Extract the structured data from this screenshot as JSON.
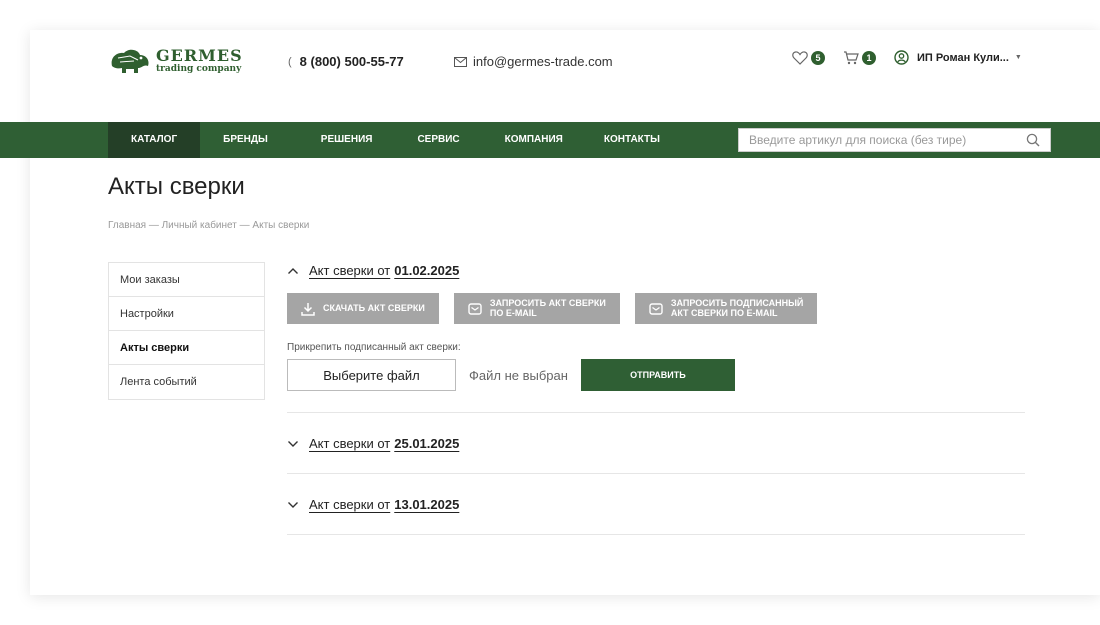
{
  "header": {
    "logo": {
      "name": "GERMES",
      "subtitle": "trading company"
    },
    "phone": "8 (800) 500-55-77",
    "email": "info@germes-trade.com",
    "favorites_count": "5",
    "cart_count": "1",
    "user_name": "ИП Роман Кули...",
    "icons": {
      "phone": "phone-icon",
      "email": "envelope-icon",
      "favorites": "heart-icon",
      "cart": "cart-icon",
      "user": "user-circle-icon",
      "user_menu": "caret-down-icon"
    }
  },
  "nav": {
    "items": [
      {
        "label": "КАТАЛОГ",
        "active": true
      },
      {
        "label": "БРЕНДЫ"
      },
      {
        "label": "РЕШЕНИЯ"
      },
      {
        "label": "СЕРВИС"
      },
      {
        "label": "КОМПАНИЯ"
      },
      {
        "label": "КОНТАКТЫ"
      }
    ],
    "search_placeholder": "Введите артикул для поиска (без тире)",
    "search_icon": "search-icon"
  },
  "page": {
    "title": "Акты сверки",
    "breadcrumb": "Главная — Личный кабинет — Акты сверки"
  },
  "sidebar": {
    "items": [
      {
        "label": "Мои заказы"
      },
      {
        "label": "Настройки"
      },
      {
        "label": "Акты сверки",
        "active": true
      },
      {
        "label": "Лента событий"
      }
    ]
  },
  "reconciliation": {
    "items": [
      {
        "label": "Акт сверки от",
        "date": "01.02.2025",
        "expanded": true
      },
      {
        "label": "Акт сверки от",
        "date": "25.01.2025",
        "expanded": false
      },
      {
        "label": "Акт сверки от",
        "date": "13.01.2025",
        "expanded": false
      }
    ],
    "actions": {
      "download": "СКАЧАТЬ АКТ СВЕРКИ",
      "request_email_1": "ЗАПРОСИТЬ АКТ СВЕРКИ",
      "request_email_2": "ПО E-MAIL",
      "request_signed_1": "ЗАПРОСИТЬ ПОДПИСАННЫЙ",
      "request_signed_2": "АКТ СВЕРКИ ПО E-MAIL"
    },
    "attach_label": "Прикрепить подписанный акт сверки:",
    "file_button": "Выберите файл",
    "file_status": "Файл не выбран",
    "send_button": "ОТПРАВИТЬ"
  },
  "colors": {
    "brand_green": "#2f5f34",
    "active_nav": "#243f27",
    "grey_button": "#a5a5a5"
  }
}
